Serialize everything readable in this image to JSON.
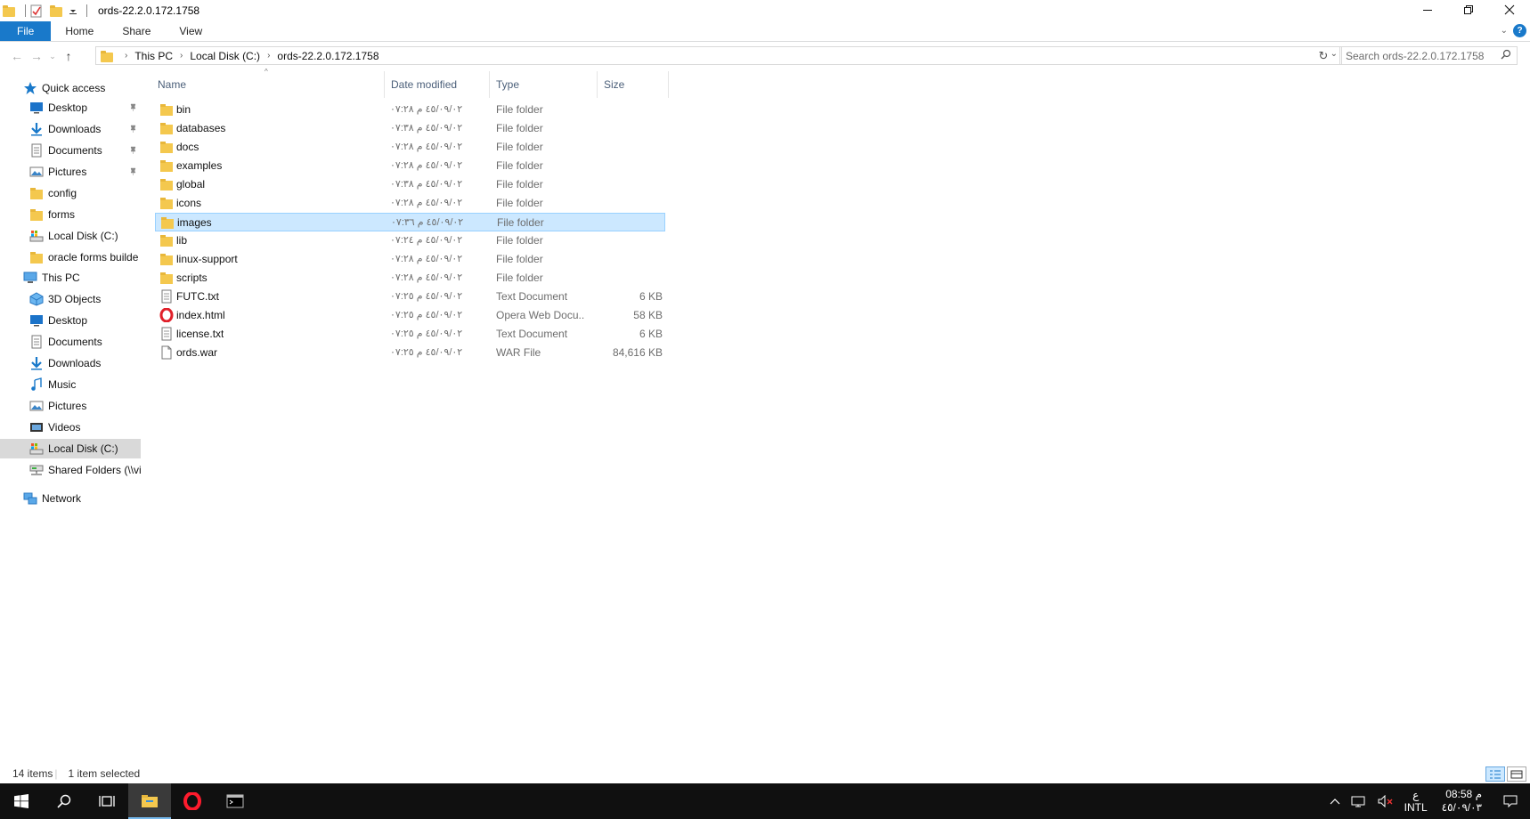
{
  "window": {
    "title": "ords-22.2.0.172.1758",
    "minimize_icon": "minimize-icon",
    "maximize_icon": "restore-icon",
    "close_icon": "close-icon"
  },
  "ribbon": {
    "tabs": [
      "File",
      "Home",
      "Share",
      "View"
    ],
    "help": "?"
  },
  "address": {
    "crumbs": [
      "This PC",
      "Local Disk (C:)",
      "ords-22.2.0.172.1758"
    ],
    "search_placeholder": "Search ords-22.2.0.172.1758"
  },
  "nav": {
    "quick_access": "Quick access",
    "quick_items": [
      {
        "label": "Desktop",
        "icon": "desktop-icon",
        "pinned": true
      },
      {
        "label": "Downloads",
        "icon": "downloads-icon",
        "pinned": true
      },
      {
        "label": "Documents",
        "icon": "documents-icon",
        "pinned": true
      },
      {
        "label": "Pictures",
        "icon": "pictures-icon",
        "pinned": true
      },
      {
        "label": "config",
        "icon": "folder-icon",
        "pinned": false
      },
      {
        "label": "forms",
        "icon": "folder-icon",
        "pinned": false
      },
      {
        "label": "Local Disk (C:)",
        "icon": "drive-icon",
        "pinned": false
      },
      {
        "label": "oracle forms builde",
        "icon": "folder-icon",
        "pinned": false
      }
    ],
    "this_pc": "This PC",
    "pc_items": [
      {
        "label": "3D Objects",
        "icon": "3d-objects-icon"
      },
      {
        "label": "Desktop",
        "icon": "desktop-icon"
      },
      {
        "label": "Documents",
        "icon": "documents-icon"
      },
      {
        "label": "Downloads",
        "icon": "downloads-icon"
      },
      {
        "label": "Music",
        "icon": "music-icon"
      },
      {
        "label": "Pictures",
        "icon": "pictures-icon"
      },
      {
        "label": "Videos",
        "icon": "videos-icon"
      },
      {
        "label": "Local Disk (C:)",
        "icon": "drive-icon"
      },
      {
        "label": "Shared Folders (\\\\vi",
        "icon": "network-drive-icon"
      }
    ],
    "network": "Network"
  },
  "columns": {
    "name": "Name",
    "date": "Date modified",
    "type": "Type",
    "size": "Size"
  },
  "files": [
    {
      "name": "bin",
      "date": "٤٥/٠٩/٠٢ م ٠٧:٢٨",
      "type": "File folder",
      "size": "",
      "kind": "folder"
    },
    {
      "name": "databases",
      "date": "٤٥/٠٩/٠٢ م ٠٧:٣٨",
      "type": "File folder",
      "size": "",
      "kind": "folder"
    },
    {
      "name": "docs",
      "date": "٤٥/٠٩/٠٢ م ٠٧:٢٨",
      "type": "File folder",
      "size": "",
      "kind": "folder"
    },
    {
      "name": "examples",
      "date": "٤٥/٠٩/٠٢ م ٠٧:٢٨",
      "type": "File folder",
      "size": "",
      "kind": "folder"
    },
    {
      "name": "global",
      "date": "٤٥/٠٩/٠٢ م ٠٧:٣٨",
      "type": "File folder",
      "size": "",
      "kind": "folder"
    },
    {
      "name": "icons",
      "date": "٤٥/٠٩/٠٢ م ٠٧:٢٨",
      "type": "File folder",
      "size": "",
      "kind": "folder"
    },
    {
      "name": "images",
      "date": "٤٥/٠٩/٠٢ م ٠٧:٣٦",
      "type": "File folder",
      "size": "",
      "kind": "folder",
      "selected": true
    },
    {
      "name": "lib",
      "date": "٤٥/٠٩/٠٢ م ٠٧:٢٤",
      "type": "File folder",
      "size": "",
      "kind": "folder"
    },
    {
      "name": "linux-support",
      "date": "٤٥/٠٩/٠٢ م ٠٧:٢٨",
      "type": "File folder",
      "size": "",
      "kind": "folder"
    },
    {
      "name": "scripts",
      "date": "٤٥/٠٩/٠٢ م ٠٧:٢٨",
      "type": "File folder",
      "size": "",
      "kind": "folder"
    },
    {
      "name": "FUTC.txt",
      "date": "٤٥/٠٩/٠٢ م ٠٧:٢٥",
      "type": "Text Document",
      "size": "6 KB",
      "kind": "text"
    },
    {
      "name": "index.html",
      "date": "٤٥/٠٩/٠٢ م ٠٧:٢٥",
      "type": "Opera Web Docu...",
      "size": "58 KB",
      "kind": "opera"
    },
    {
      "name": "license.txt",
      "date": "٤٥/٠٩/٠٢ م ٠٧:٢٥",
      "type": "Text Document",
      "size": "6 KB",
      "kind": "text"
    },
    {
      "name": "ords.war",
      "date": "٤٥/٠٩/٠٢ م ٠٧:٢٥",
      "type": "WAR File",
      "size": "84,616 KB",
      "kind": "file"
    }
  ],
  "status": {
    "count": "14 items",
    "selection": "1 item selected"
  },
  "taskbar": {
    "lang_top": "ع",
    "lang_bottom": "INTL",
    "time": "08:58 م",
    "date": "٤٥/٠٩/٠٣"
  },
  "colors": {
    "accent": "#1979ca",
    "selection": "#cce8ff",
    "folder": "#f4c84e"
  }
}
